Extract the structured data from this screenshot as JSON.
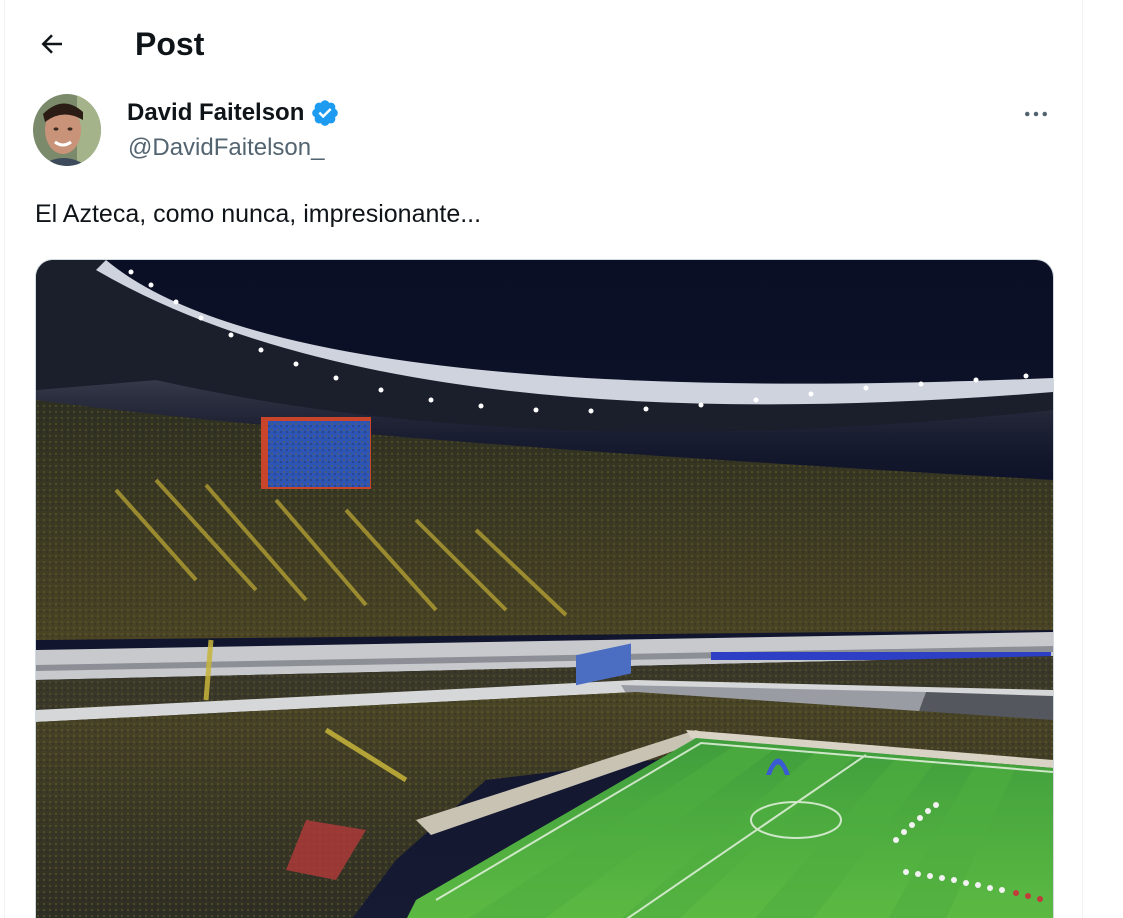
{
  "header": {
    "title": "Post",
    "back_icon": "arrow-left-icon"
  },
  "author": {
    "name": "David Faitelson",
    "handle": "@DavidFaitelson_",
    "verified": true,
    "verified_color": "#1d9bf0"
  },
  "post": {
    "text": "El Azteca, como nunca, impresionante..."
  },
  "media": {
    "kind": "photo"
  },
  "icons": {
    "more": "more-horizontal-icon",
    "verified": "verified-badge-icon"
  },
  "colors": {
    "text_primary": "#0f1419",
    "text_secondary": "#536471",
    "border": "#cfd9de"
  }
}
